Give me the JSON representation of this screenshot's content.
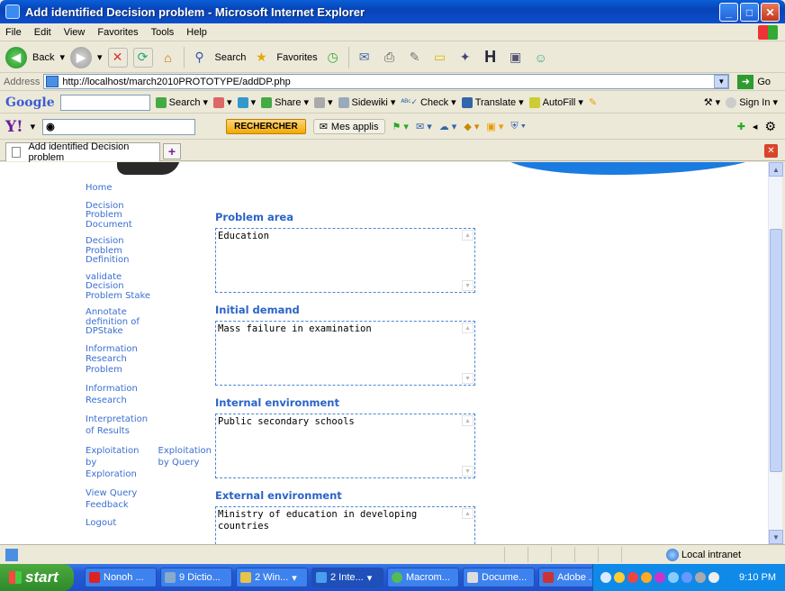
{
  "window": {
    "title": "Add identified Decision problem - Microsoft Internet Explorer"
  },
  "menu": [
    "File",
    "Edit",
    "View",
    "Favorites",
    "Tools",
    "Help"
  ],
  "toolbar": {
    "back_label": "Back",
    "search_label": "Search",
    "favorites_label": "Favorites"
  },
  "address": {
    "label": "Address",
    "url": "http://localhost/march2010PROTOTYPE/addDP.php",
    "go_label": "Go"
  },
  "google_bar": {
    "logo": "Google",
    "search_label": "Search",
    "share_label": "Share",
    "sidewiki_label": "Sidewiki",
    "check_label": "Check",
    "translate_label": "Translate",
    "autofill_label": "AutoFill",
    "signin_label": "Sign In"
  },
  "yahoo_bar": {
    "logo": "Y!",
    "search_button": "RECHERCHER",
    "apps_label": "Mes applis"
  },
  "tabs": [
    {
      "label": "Add identified Decision problem",
      "active": true
    }
  ],
  "nav": {
    "home": "Home",
    "decision_problem_document": [
      "Decision",
      "Problem",
      "Document"
    ],
    "decision_problem_definition": [
      "Decision",
      "Problem",
      "Definition"
    ],
    "validate_stake": [
      "validate",
      "Decision",
      "Problem Stake"
    ],
    "annotate": [
      "Annotate",
      "definition of",
      "DPStake"
    ],
    "info_research_problem": [
      "Information",
      "Research",
      "Problem"
    ],
    "info_research": [
      "Information",
      "Research"
    ],
    "interpretation": [
      "Interpretation",
      "of Results"
    ],
    "exploitation_exploration": [
      "Exploitation by",
      "Exploration"
    ],
    "exploitation_query": [
      "Exploitation",
      "by Query"
    ],
    "view_query_feedback": [
      "View Query",
      "Feedback"
    ],
    "logout": "Logout"
  },
  "form": {
    "fields": [
      {
        "label": "Problem area",
        "value": "Education"
      },
      {
        "label": "Initial demand",
        "value": "Mass failure in examination"
      },
      {
        "label": "Internal environment",
        "value": "Public secondary schools"
      },
      {
        "label": "External environment",
        "value": "Ministry of education in developing countries"
      }
    ]
  },
  "status": {
    "zone": "Local intranet"
  },
  "taskbar": {
    "start_label": "start",
    "tasks": [
      "Nonoh ...",
      "9 Dictio...",
      "2 Win...",
      "2 Inte...",
      "Macrom...",
      "Docume...",
      "Adobe ..."
    ],
    "clock": "9:10 PM"
  }
}
